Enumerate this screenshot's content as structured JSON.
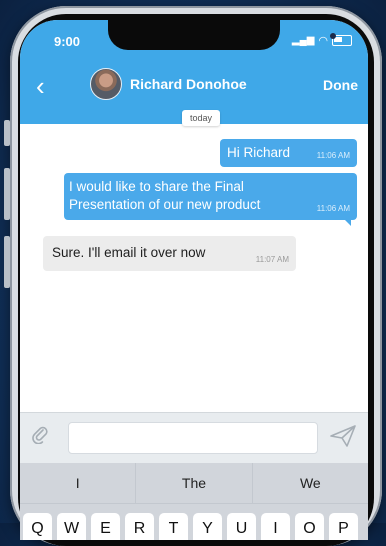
{
  "status_bar": {
    "time": "9:00"
  },
  "header": {
    "back_icon": "chevron-left-icon",
    "contact_name": "Richard Donohoe",
    "done_label": "Done"
  },
  "chat": {
    "date_label": "today",
    "messages": [
      {
        "direction": "outgoing",
        "text": "Hi Richard",
        "time": "11:06 AM"
      },
      {
        "direction": "outgoing",
        "line1": "I would like to share the Final",
        "line2": "Presentation of our new product",
        "time": "11:06 AM"
      },
      {
        "direction": "incoming",
        "text": "Sure. I'll email it over now",
        "time": "11:07 AM"
      }
    ]
  },
  "composer": {
    "attach_icon": "paperclip-icon",
    "send_icon": "send-icon",
    "placeholder": ""
  },
  "keyboard": {
    "suggestions": [
      "I",
      "The",
      "We"
    ],
    "row1": [
      "Q",
      "W",
      "E",
      "R",
      "T",
      "Y",
      "U",
      "I",
      "O",
      "P"
    ]
  },
  "colors": {
    "accent": "#3fa8e8",
    "outgoing_bubble": "#4aa9ea",
    "incoming_bubble": "#ececec"
  }
}
